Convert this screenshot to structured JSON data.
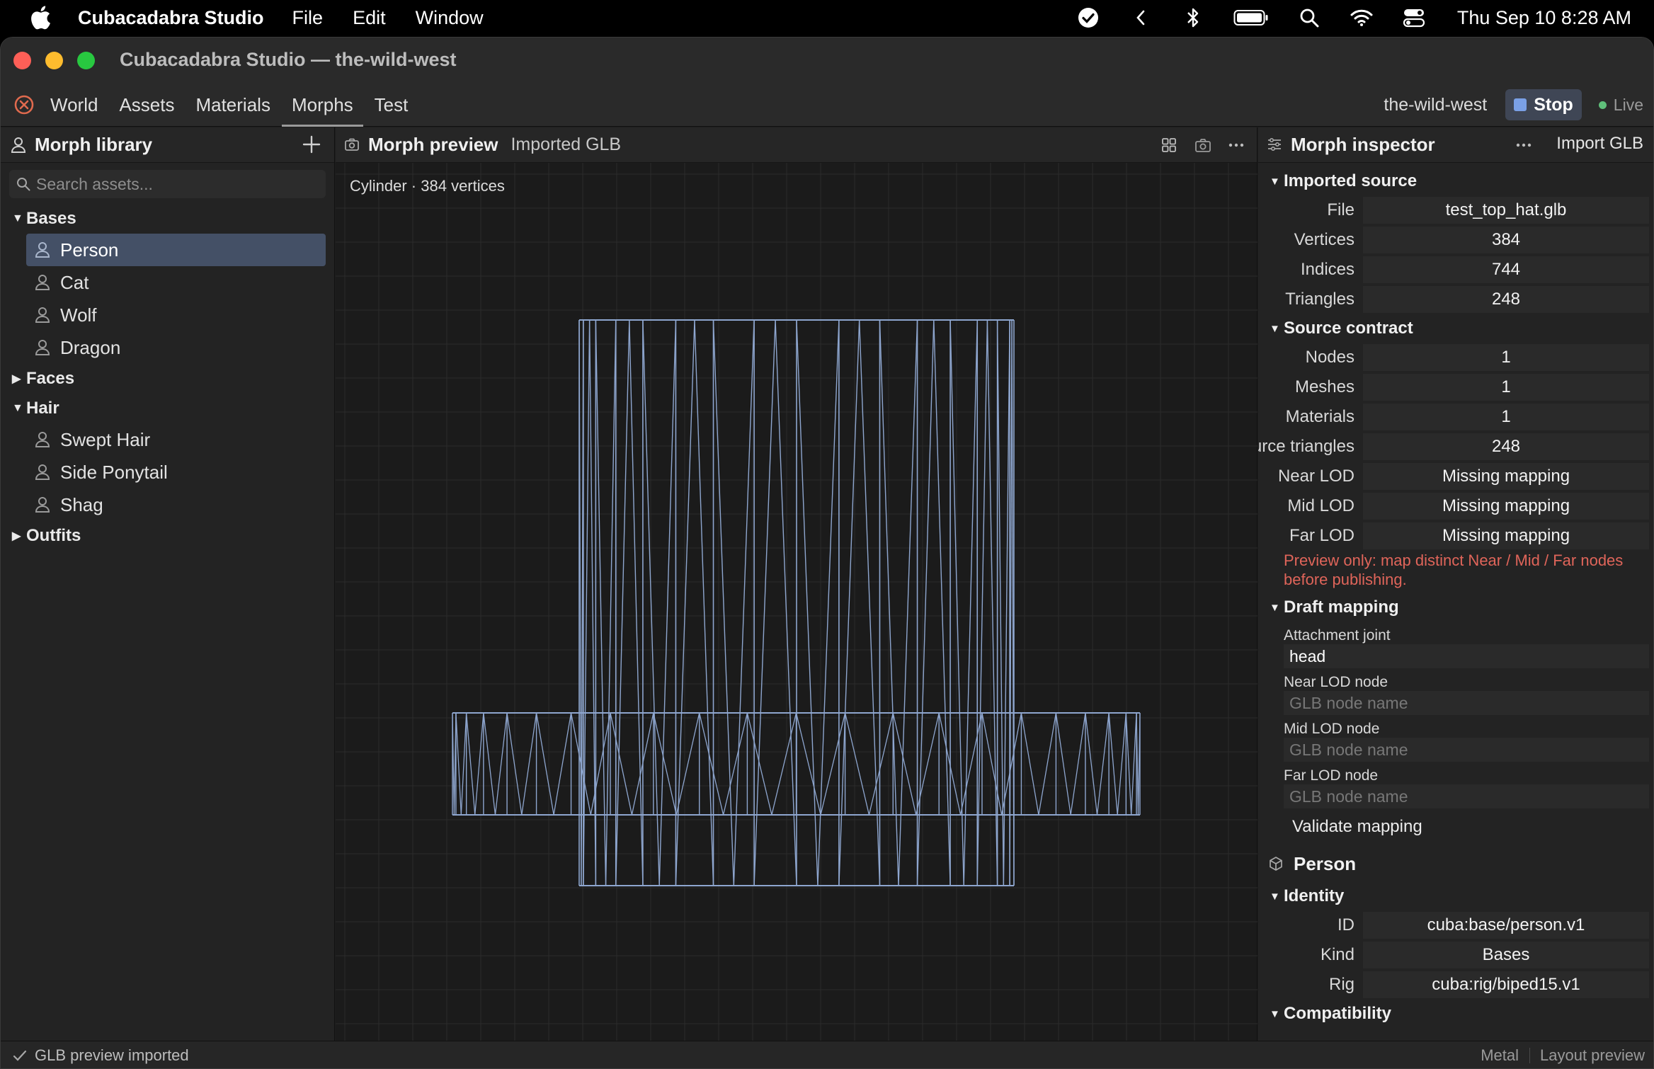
{
  "menubar": {
    "app_name": "Cubacadabra Studio",
    "items": [
      "File",
      "Edit",
      "Window"
    ],
    "clock": "Thu Sep 10  8:28 AM",
    "status_icons": [
      "checkmark-circle-icon",
      "chevron-left-icon",
      "bluetooth-icon",
      "battery-icon",
      "spotlight-search-icon",
      "wifi-icon",
      "control-center-icon"
    ]
  },
  "window": {
    "title": "Cubacadabra Studio — the-wild-west"
  },
  "tabs": {
    "items": [
      "World",
      "Assets",
      "Materials",
      "Morphs",
      "Test"
    ],
    "active": "Morphs",
    "project": "the-wild-west",
    "stop_label": "Stop",
    "live_label": "Live"
  },
  "library": {
    "title": "Morph library",
    "search_placeholder": "Search assets...",
    "groups": [
      {
        "name": "Bases",
        "expanded": true,
        "items": [
          "Person",
          "Cat",
          "Wolf",
          "Dragon"
        ]
      },
      {
        "name": "Faces",
        "expanded": false,
        "items": []
      },
      {
        "name": "Hair",
        "expanded": true,
        "items": [
          "Swept Hair",
          "Side Ponytail",
          "Shag"
        ]
      },
      {
        "name": "Outfits",
        "expanded": false,
        "items": []
      }
    ],
    "selected": "Person"
  },
  "preview": {
    "title": "Morph preview",
    "subtitle": "Imported GLB",
    "mesh_info": "Cylinder · 384 vertices",
    "wire_color": "#8ea6cf",
    "grid_color": "#2b2b2b"
  },
  "inspector": {
    "title": "Morph inspector",
    "import_label": "Import GLB",
    "imported_source": {
      "label": "Imported source",
      "rows": [
        {
          "key": "File",
          "value": "test_top_hat.glb"
        },
        {
          "key": "Vertices",
          "value": "384"
        },
        {
          "key": "Indices",
          "value": "744"
        },
        {
          "key": "Triangles",
          "value": "248"
        }
      ]
    },
    "source_contract": {
      "label": "Source contract",
      "rows": [
        {
          "key": "Nodes",
          "value": "1"
        },
        {
          "key": "Meshes",
          "value": "1"
        },
        {
          "key": "Materials",
          "value": "1"
        },
        {
          "key": "Source triangles",
          "value": "248"
        },
        {
          "key": "Near LOD",
          "value": "Missing mapping"
        },
        {
          "key": "Mid LOD",
          "value": "Missing mapping"
        },
        {
          "key": "Far LOD",
          "value": "Missing mapping"
        }
      ],
      "warning": "Preview only: map distinct Near / Mid / Far nodes before publishing."
    },
    "draft_mapping": {
      "label": "Draft mapping",
      "attachment_label": "Attachment joint",
      "attachment_value": "head",
      "near_label": "Near LOD node",
      "mid_label": "Mid LOD node",
      "far_label": "Far LOD node",
      "node_placeholder": "GLB node name",
      "validate_label": "Validate mapping"
    },
    "asset_name": "Person",
    "identity": {
      "label": "Identity",
      "rows": [
        {
          "key": "ID",
          "value": "cuba:base/person.v1"
        },
        {
          "key": "Kind",
          "value": "Bases"
        },
        {
          "key": "Rig",
          "value": "cuba:rig/biped15.v1"
        }
      ]
    },
    "compatibility_label": "Compatibility"
  },
  "statusbar": {
    "message": "GLB preview imported",
    "renderer": "Metal",
    "mode": "Layout preview"
  }
}
